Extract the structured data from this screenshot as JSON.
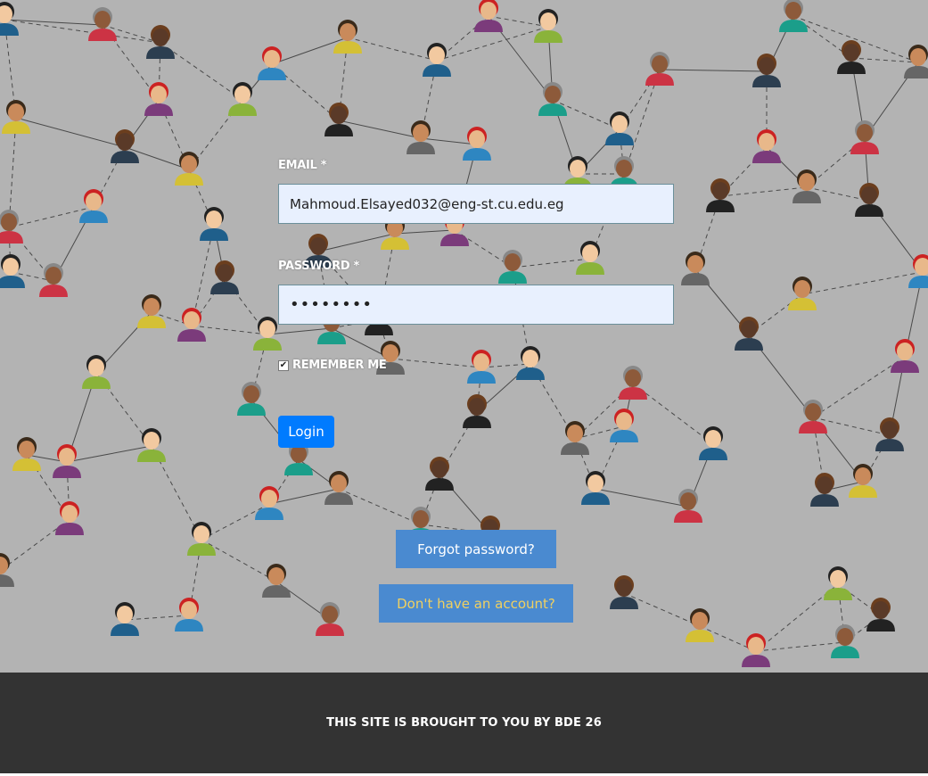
{
  "login_form": {
    "email_label": "EMAIL *",
    "email_value": "Mahmoud.Elsayed032@eng-st.cu.edu.eg",
    "password_label": "PASSWORD *",
    "password_value": "password",
    "remember_label": "REMEMBER ME",
    "remember_checked": true,
    "login_button": "Login"
  },
  "links": {
    "forgot_password": "Forgot password?",
    "no_account": "Don't have an account?"
  },
  "footer": {
    "text": "THIS SITE IS BROUGHT TO YOU BY BDE 26"
  },
  "colors": {
    "background": "#b3b3b3",
    "input_bg": "#e8f0fe",
    "primary_button": "#007bff",
    "link_button": "#4a8ad0",
    "signup_text": "#f0d060",
    "footer_bg": "#333333"
  },
  "background_image": "people-network-illustration"
}
